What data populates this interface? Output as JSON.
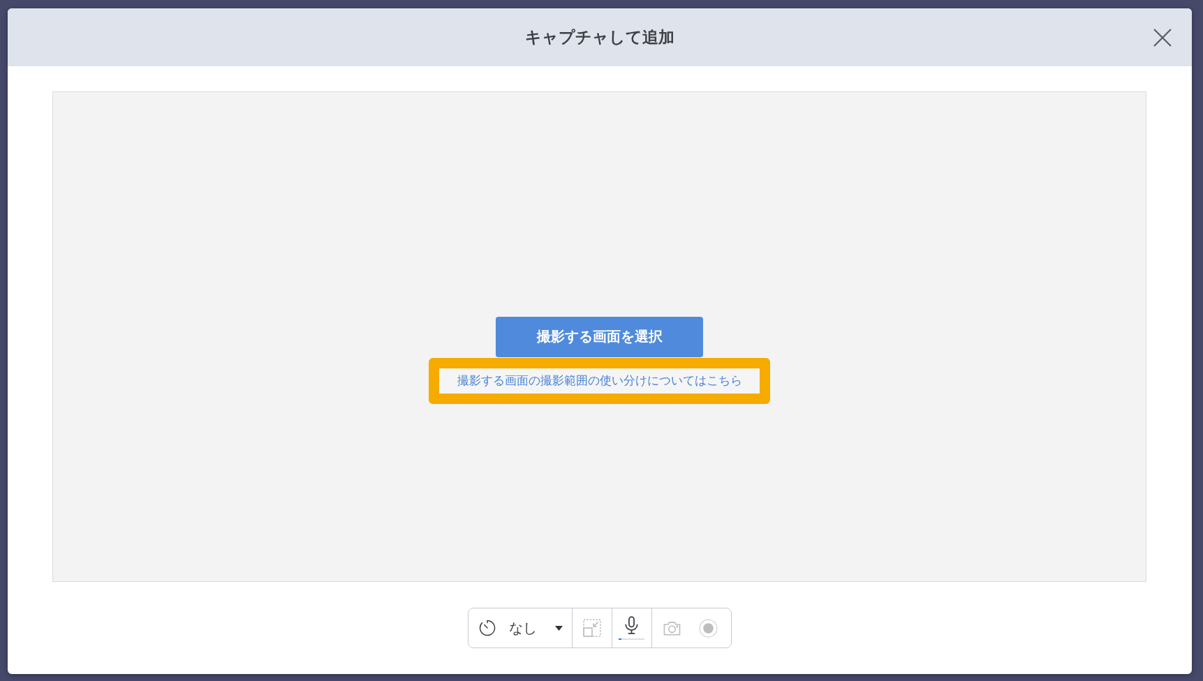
{
  "dialog": {
    "title": "キャプチャして追加"
  },
  "preview": {
    "select_button": "撮影する画面を選択",
    "help_link": {
      "text": "撮影する画面の撮影範囲の使い分けについてはこちら",
      "highlighted": true
    }
  },
  "toolbar": {
    "timer": {
      "value": "なし"
    },
    "sections": [
      {
        "tools": [
          {
            "kind": "fit",
            "disabled": true
          }
        ]
      },
      {
        "tools": [
          {
            "kind": "mic",
            "disabled": false,
            "level": 0.1
          }
        ]
      },
      {
        "tools": [
          {
            "kind": "camera",
            "disabled": true
          },
          {
            "kind": "record",
            "disabled": true
          }
        ]
      }
    ]
  }
}
